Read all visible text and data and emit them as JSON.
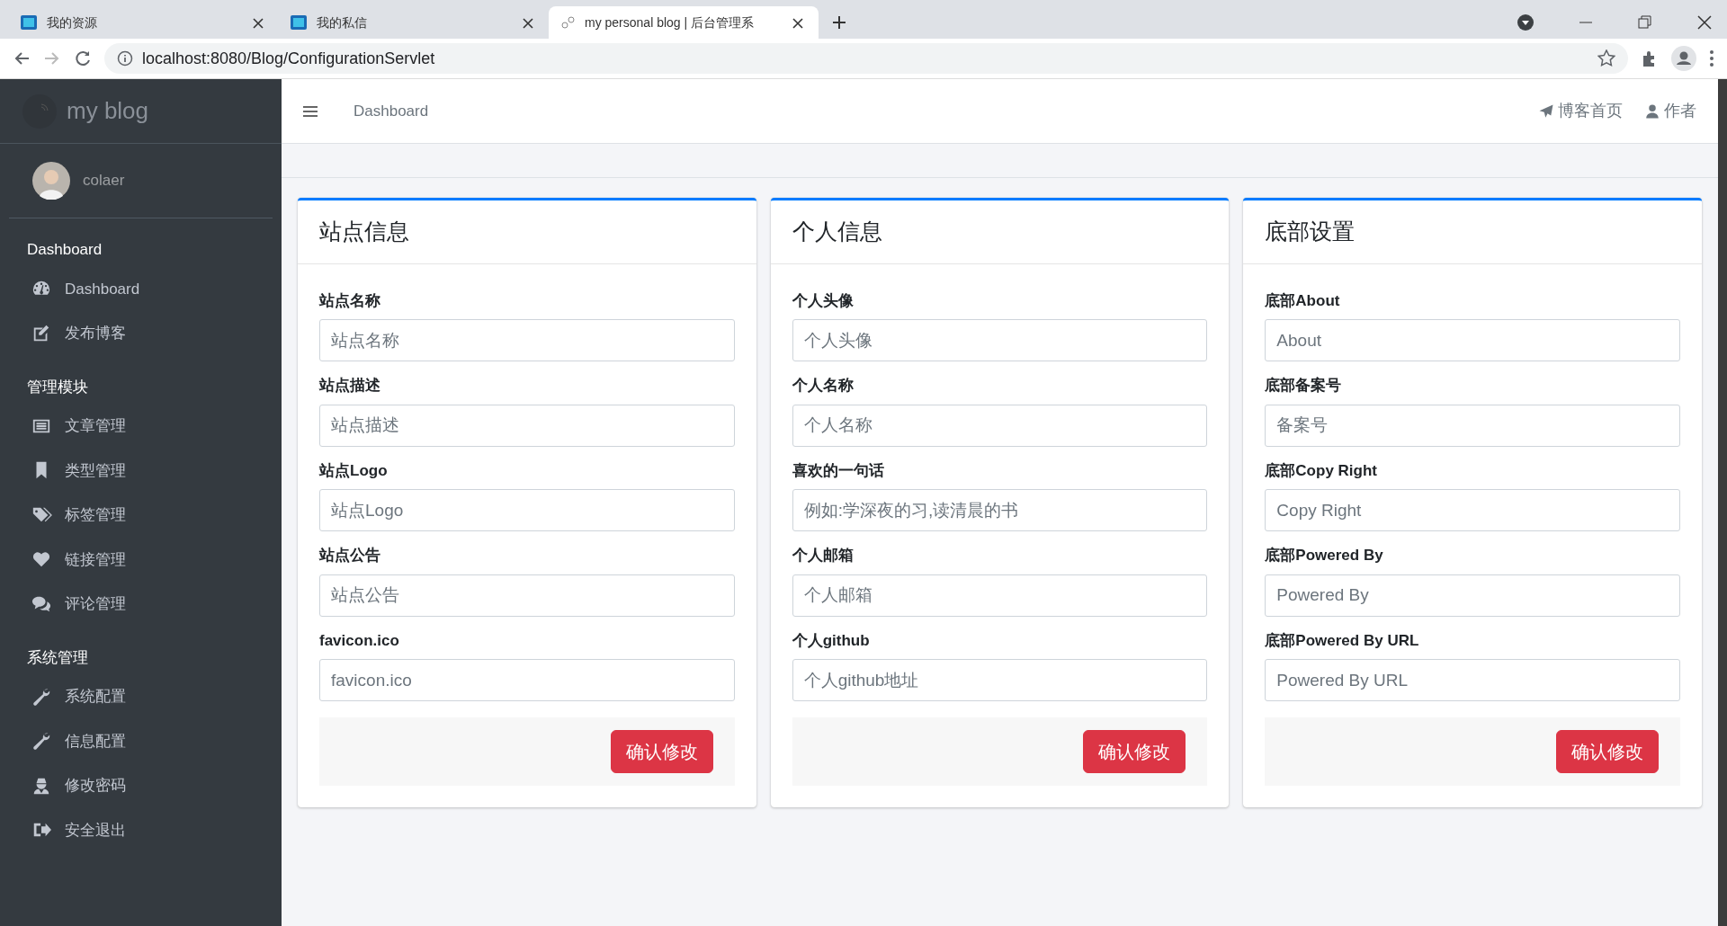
{
  "browser": {
    "tabs": [
      {
        "title": "我的资源",
        "selected": false,
        "kind": "logo"
      },
      {
        "title": "我的私信",
        "selected": false,
        "kind": "logo"
      },
      {
        "title": "my personal blog | 后台管理系",
        "selected": true,
        "kind": "blank"
      }
    ],
    "url": "localhost:8080/Blog/ConfigurationServlet"
  },
  "sidebar": {
    "brand": "my blog",
    "user": "colaer",
    "sections": [
      {
        "title": "Dashboard",
        "items": [
          {
            "label": "Dashboard",
            "kind": "gauge"
          },
          {
            "label": "发布博客",
            "kind": "edit"
          }
        ]
      },
      {
        "title": "管理模块",
        "items": [
          {
            "label": "文章管理",
            "kind": "list"
          },
          {
            "label": "类型管理",
            "kind": "bookmark"
          },
          {
            "label": "标签管理",
            "kind": "tags"
          },
          {
            "label": "链接管理",
            "kind": "heart"
          },
          {
            "label": "评论管理",
            "kind": "comments"
          }
        ]
      },
      {
        "title": "系统管理",
        "items": [
          {
            "label": "系统配置",
            "kind": "wrench"
          },
          {
            "label": "信息配置",
            "kind": "wrench"
          },
          {
            "label": "修改密码",
            "kind": "secret"
          },
          {
            "label": "安全退出",
            "kind": "signout"
          }
        ]
      }
    ]
  },
  "header": {
    "title": "Dashboard",
    "links": [
      {
        "label": "博客首页",
        "kind": "plane"
      },
      {
        "label": "作者",
        "kind": "user"
      }
    ]
  },
  "cards": [
    {
      "title": "站点信息",
      "fields": [
        {
          "label": "站点名称",
          "placeholder": "站点名称"
        },
        {
          "label": "站点描述",
          "placeholder": "站点描述"
        },
        {
          "label": "站点Logo",
          "placeholder": "站点Logo"
        },
        {
          "label": "站点公告",
          "placeholder": "站点公告"
        },
        {
          "label": "favicon.ico",
          "placeholder": "favicon.ico"
        }
      ],
      "button": "确认修改"
    },
    {
      "title": "个人信息",
      "fields": [
        {
          "label": "个人头像",
          "placeholder": "个人头像"
        },
        {
          "label": "个人名称",
          "placeholder": "个人名称"
        },
        {
          "label": "喜欢的一句话",
          "placeholder": "例如:学深夜的习,读清晨的书"
        },
        {
          "label": "个人邮箱",
          "placeholder": "个人邮箱"
        },
        {
          "label": "个人github",
          "placeholder": "个人github地址"
        }
      ],
      "button": "确认修改"
    },
    {
      "title": "底部设置",
      "fields": [
        {
          "label": "底部About",
          "placeholder": "About"
        },
        {
          "label": "底部备案号",
          "placeholder": "备案号"
        },
        {
          "label": "底部Copy Right",
          "placeholder": "Copy Right"
        },
        {
          "label": "底部Powered By",
          "placeholder": "Powered By"
        },
        {
          "label": "底部Powered By URL",
          "placeholder": "Powered By URL"
        }
      ],
      "button": "确认修改"
    }
  ]
}
